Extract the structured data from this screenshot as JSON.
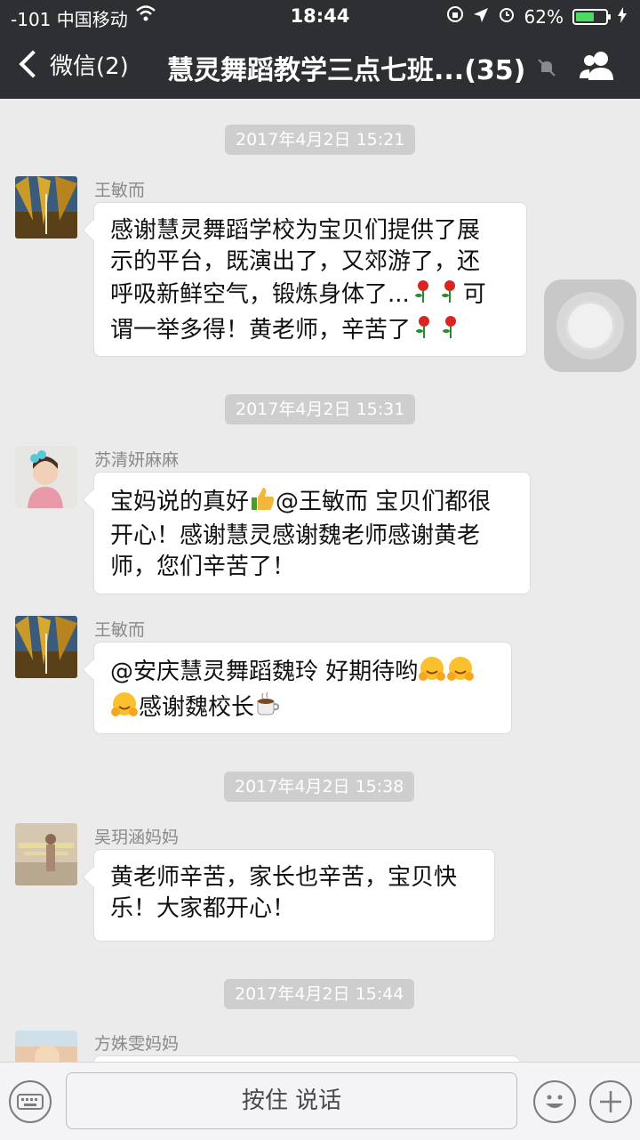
{
  "status_bar": {
    "signal": "-101 中国移动",
    "time": "18:44",
    "battery": "62%",
    "battery_level": 0.62
  },
  "nav": {
    "back_label": "微信(2)",
    "title": "慧灵舞蹈教学三点七班...(35)"
  },
  "messages": [
    {
      "timestamp": "2017年4月2日 15:21"
    },
    {
      "sender": "王敏而",
      "parts": [
        "感谢慧灵舞蹈学校为宝贝们提供了展",
        "示的平台，既演出了，又郊游了，还",
        "呼吸新鲜空气，锻炼身体了...",
        "可",
        "谓一举多得！黄老师，辛苦了"
      ]
    },
    {
      "timestamp": "2017年4月2日 15:31"
    },
    {
      "sender": "苏清妍麻麻",
      "parts": [
        "宝妈说的真好",
        "@王敏而 宝贝们都很",
        "开心！感谢慧灵感谢魏老师感谢黄老",
        "师，您们辛苦了！"
      ]
    },
    {
      "sender": "王敏而",
      "parts": [
        "@安庆慧灵舞蹈魏玲 好期待哟",
        "感谢魏校长"
      ]
    },
    {
      "timestamp": "2017年4月2日 15:38"
    },
    {
      "sender": "吴玥涵妈妈",
      "parts": [
        "黄老师辛苦，家长也辛苦，宝贝快",
        "乐！大家都开心！"
      ]
    },
    {
      "timestamp": "2017年4月2日 15:44"
    },
    {
      "sender": "方姝雯妈妈"
    }
  ],
  "input_bar": {
    "hold_to_talk": "按住 说话"
  },
  "colors": {
    "nav_bg": "#2e2f33",
    "chat_bg": "#ebebeb",
    "battery_green": "#4cd964",
    "timestamp_bg": "#cecece"
  }
}
